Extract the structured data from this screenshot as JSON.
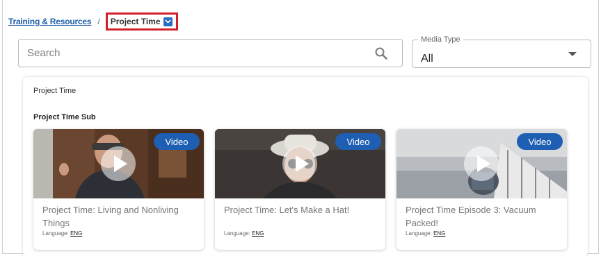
{
  "breadcrumb": {
    "parent": "Training & Resources",
    "separator": "/",
    "current": "Project Time"
  },
  "search": {
    "placeholder": "Search"
  },
  "media_type": {
    "label": "Media Type",
    "value": "All"
  },
  "panel": {
    "title": "Project Time",
    "subtitle": "Project Time Sub",
    "cards": [
      {
        "badge": "Video",
        "title": "Project Time: Living and Nonliving Things",
        "language_label": "Language:",
        "language": "ENG"
      },
      {
        "badge": "Video",
        "title": "Project Time: Let's Make a Hat!",
        "language_label": "Language:",
        "language": "ENG"
      },
      {
        "badge": "Video",
        "title": "Project Time Episode 3: Vacuum Packed!",
        "language_label": "Language:",
        "language": "ENG"
      }
    ]
  },
  "colors": {
    "link": "#1f5ea8",
    "badge": "#1e5fb4",
    "highlight_border": "#d0202a"
  }
}
